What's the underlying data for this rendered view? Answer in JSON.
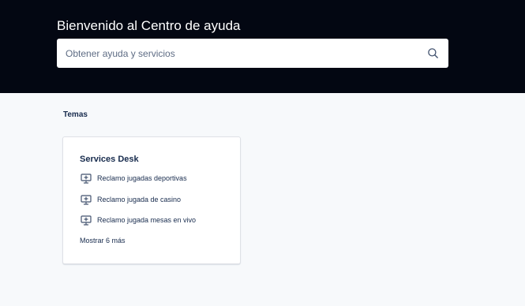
{
  "hero": {
    "title": "Bienvenido al Centro de ayuda",
    "background_color": "#030712"
  },
  "search": {
    "placeholder": "Obtener ayuda y servicios",
    "value": "",
    "icon": "search-icon"
  },
  "topics": {
    "heading": "Temas"
  },
  "card": {
    "title": "Services Desk",
    "items": [
      {
        "label": "Reclamo jugadas deportivas",
        "icon": "desktop-plus-icon"
      },
      {
        "label": "Reclamo jugada de casino",
        "icon": "desktop-plus-icon"
      },
      {
        "label": "Reclamo jugada mesas en vivo",
        "icon": "desktop-plus-icon"
      }
    ],
    "show_more": "Mostrar 6 más"
  },
  "colors": {
    "page_background": "#f7f9fb",
    "text": "#172b4d",
    "card_border": "#dfe1e6"
  }
}
